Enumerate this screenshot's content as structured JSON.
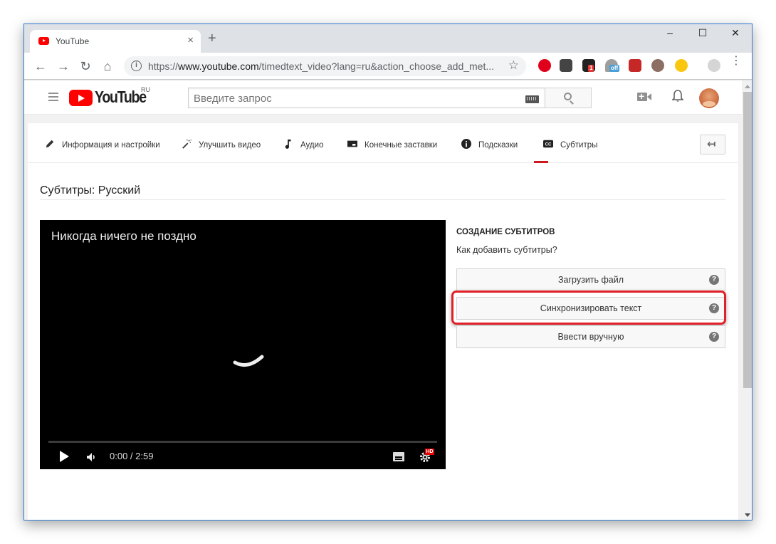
{
  "browser": {
    "tab_title": "YouTube",
    "tab_close": "×",
    "new_tab": "+",
    "window_controls": {
      "minimize": "–",
      "maximize": "☐",
      "close": "✕"
    },
    "nav": {
      "back": "←",
      "forward": "→",
      "reload": "↻",
      "home": "⌂"
    },
    "url_scheme": "https://",
    "url_host": "www.youtube.com",
    "url_path": "/timedtext_video?lang=ru&action_choose_add_met...",
    "bookmark_icon": "☆",
    "extensions": [
      {
        "name": "opera-adblock",
        "color": "#e0001b"
      },
      {
        "name": "extension-gear",
        "color": "#444444"
      },
      {
        "name": "extension-dark",
        "color": "#222222",
        "badge": "1",
        "badge_color": "#e53935"
      },
      {
        "name": "extension-vpn",
        "color": "#9e9e9e",
        "badge": "off",
        "badge_color": "#4a9fd8"
      },
      {
        "name": "extension-play",
        "color": "#c62828"
      },
      {
        "name": "extension-face",
        "color": "#8d6e63"
      },
      {
        "name": "extension-coin",
        "color": "#f9c80e"
      }
    ],
    "menu_icon": "⋮"
  },
  "youtube": {
    "logo_text": "YouTube",
    "logo_region": "RU",
    "search_placeholder": "Введите запрос",
    "brand_color": "#ff0000"
  },
  "editor_tabs": [
    {
      "label": "Информация и настройки",
      "icon": "pencil-icon",
      "active": false
    },
    {
      "label": "Улучшить видео",
      "icon": "magic-wand-icon",
      "active": false
    },
    {
      "label": "Аудио",
      "icon": "music-note-icon",
      "active": false
    },
    {
      "label": "Конечные заставки",
      "icon": "end-screen-icon",
      "active": false
    },
    {
      "label": "Подсказки",
      "icon": "info-icon",
      "active": false
    },
    {
      "label": "Субтитры",
      "icon": "cc-icon",
      "active": true
    }
  ],
  "back_button": "↤",
  "page_title": "Субтитры: Русский",
  "video": {
    "title": "Никогда ничего не поздно",
    "time": "0:00 / 2:59",
    "progress_fraction": 0,
    "hd_badge": "HD"
  },
  "panel": {
    "heading": "СОЗДАНИЕ СУБТИТРОВ",
    "subheading": "Как добавить субтитры?",
    "options": [
      {
        "label": "Загрузить файл",
        "help": "?",
        "highlighted": false
      },
      {
        "label": "Синхронизировать текст",
        "help": "?",
        "highlighted": true
      },
      {
        "label": "Ввести вручную",
        "help": "?",
        "highlighted": false
      }
    ],
    "highlight_color": "#e01f26"
  }
}
